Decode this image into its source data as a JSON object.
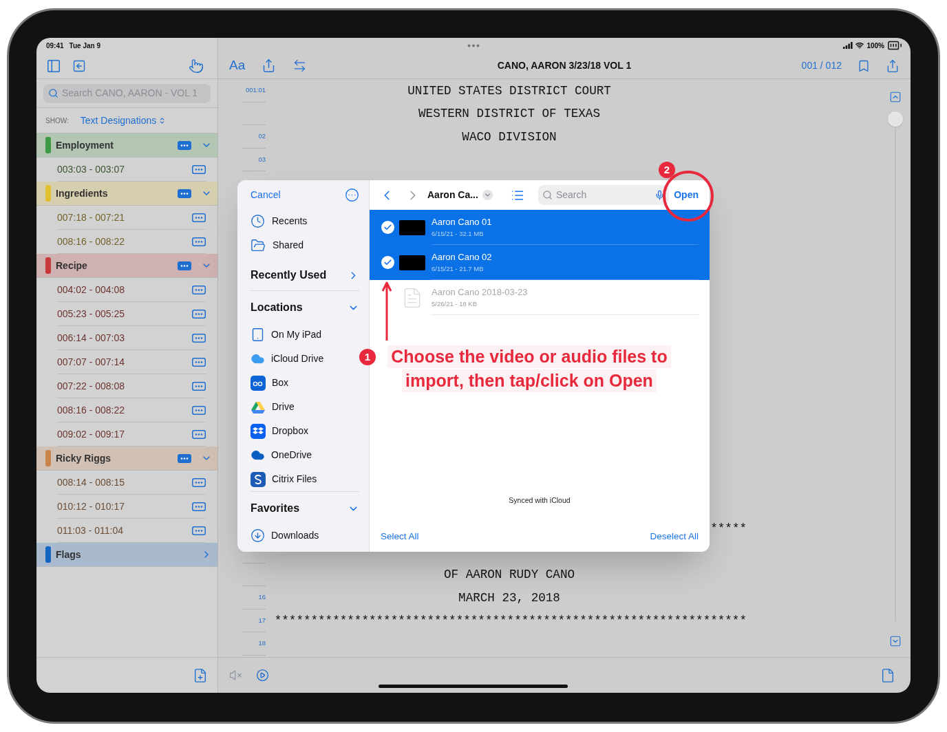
{
  "status_bar": {
    "time": "09:41",
    "date": "Tue Jan 9",
    "battery": "100%"
  },
  "sidebar": {
    "search": {
      "placeholder": "Search CANO, AARON - VOL 1"
    },
    "show_label": "SHOW:",
    "show_value": "Text Designations",
    "sections": [
      {
        "name": "Employment",
        "color": "#3f9a45",
        "kind": "group",
        "expanded": true,
        "items": [
          "003:03 - 003:07"
        ]
      },
      {
        "name": "Ingredients",
        "color": "#e0c030",
        "kind": "group",
        "expanded": true,
        "items": [
          "007:18 - 007:21",
          "008:16 - 008:22"
        ]
      },
      {
        "name": "Recipe",
        "color": "#c83a3a",
        "kind": "group",
        "expanded": true,
        "items": [
          "004:02 - 004:08",
          "005:23 - 005:25",
          "006:14 - 007:03",
          "007:07 - 007:14",
          "007:22 - 008:08",
          "008:16 - 008:22",
          "009:02 - 009:17"
        ]
      },
      {
        "name": "Ricky Riggs",
        "color": "#c8844a",
        "kind": "group",
        "expanded": true,
        "items": [
          "008:14 - 008:15",
          "010:12 - 010:17",
          "011:03 - 011:04"
        ]
      },
      {
        "name": "Flags",
        "color": "#1565c0",
        "kind": "flags",
        "expanded": false
      }
    ]
  },
  "toolbar": {
    "font_button": "Aa",
    "title": "CANO, AARON 3/23/18 VOL 1",
    "page": "001 / 012"
  },
  "transcript": {
    "top_lines": [
      {
        "number": "001:01",
        "kind": "centered",
        "text": "UNITED STATES DISTRICT COURT"
      },
      {
        "kind": "centered",
        "text": "WESTERN DISTRICT OF TEXAS"
      },
      {
        "number": "02",
        "kind": "centered",
        "text": "WACO DIVISION"
      },
      {
        "number": "03"
      }
    ],
    "bottom_lines": [
      {
        "kind": "rule",
        "text": "*****"
      },
      {
        "kind": "blank"
      },
      {
        "kind": "centered",
        "text": "OF AARON RUDY CANO"
      },
      {
        "number": "16",
        "kind": "centered",
        "text": "MARCH 23, 2018"
      },
      {
        "number": "17",
        "kind": "rule",
        "text": "*****************************************************************"
      },
      {
        "number": "18"
      }
    ]
  },
  "dialog": {
    "cancel": "Cancel",
    "top_items": [
      {
        "label": "Recents",
        "kind": "clock"
      },
      {
        "label": "Shared",
        "kind": "shared"
      }
    ],
    "sections": [
      {
        "title": "Recently Used",
        "expanded": false
      },
      {
        "title": "Locations",
        "expanded": true,
        "items": [
          {
            "label": "On My iPad",
            "kind": "device"
          },
          {
            "label": "iCloud Drive",
            "kind": "icloud"
          },
          {
            "label": "Box",
            "kind": "box"
          },
          {
            "label": "Drive",
            "kind": "drive"
          },
          {
            "label": "Dropbox",
            "kind": "dropbox"
          },
          {
            "label": "OneDrive",
            "kind": "onedrive"
          },
          {
            "label": "Citrix Files",
            "kind": "citrix"
          }
        ]
      },
      {
        "title": "Favorites",
        "expanded": true,
        "items": [
          {
            "label": "Downloads",
            "kind": "download"
          }
        ]
      }
    ],
    "forward_disabled": true,
    "folder": "Aaron Ca...",
    "search_placeholder": "Search",
    "open": "Open",
    "files": [
      {
        "name": "Aaron Cano 01",
        "meta": "6/15/21 - 32.1 MB",
        "kind": "video",
        "selected": true,
        "disabled": false
      },
      {
        "name": "Aaron Cano 02",
        "meta": "6/15/21 - 21.7 MB",
        "kind": "video",
        "selected": true,
        "disabled": false
      },
      {
        "name": "Aaron Cano 2018-03-23",
        "meta": "5/26/21 - 18 KB",
        "kind": "document",
        "selected": false,
        "disabled": true
      }
    ],
    "footer_note": "Synced with iCloud",
    "select_all": "Select All",
    "deselect_all": "Deselect All"
  },
  "annotations": {
    "open_marker": {
      "number": "2"
    },
    "callout": {
      "number": "1",
      "lines": [
        "Choose the video or audio files to",
        "import, then tap/click on Open"
      ]
    }
  }
}
